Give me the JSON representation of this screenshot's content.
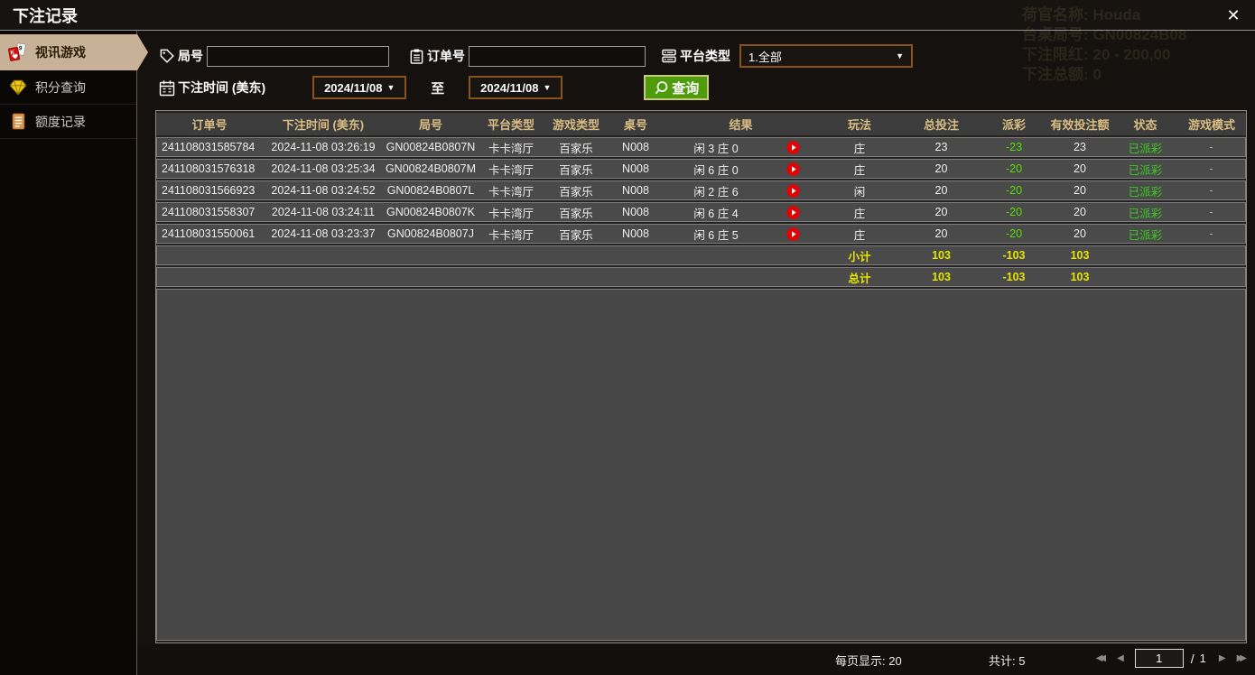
{
  "window": {
    "title": "下注记录",
    "close_icon": "✕"
  },
  "sidebar": {
    "items": [
      {
        "label": "视讯游戏",
        "icon": "playing-cards-icon",
        "active": true
      },
      {
        "label": "积分查询",
        "icon": "gem-icon",
        "active": false
      },
      {
        "label": "额度记录",
        "icon": "document-icon",
        "active": false
      }
    ]
  },
  "filters": {
    "round_label": "局号",
    "round_value": "",
    "order_label": "订单号",
    "order_value": "",
    "platform_label": "平台类型",
    "platform_value": "1.全部",
    "time_label": "下注时间 (美东)",
    "date_from": "2024/11/08",
    "to_label": "至",
    "date_to": "2024/11/08",
    "search_label": "查询",
    "caret": "▼"
  },
  "table": {
    "columns": [
      "订单号",
      "下注时间 (美东)",
      "局号",
      "平台类型",
      "游戏类型",
      "桌号",
      "结果",
      "玩法",
      "总投注",
      "派彩",
      "有效投注额",
      "状态",
      "游戏模式"
    ],
    "rows": [
      {
        "order_no": "241108031585784",
        "bet_time": "2024-11-08 03:26:19",
        "round_no": "GN00824B0807N",
        "platform": "卡卡湾厅",
        "game_type": "百家乐",
        "table_no": "N008",
        "result": "闲 3 庄 0",
        "play_type": "庄",
        "total_bet": "23",
        "payout": "-23",
        "valid_bet": "23",
        "status": "已派彩",
        "mode": "-"
      },
      {
        "order_no": "241108031576318",
        "bet_time": "2024-11-08 03:25:34",
        "round_no": "GN00824B0807M",
        "platform": "卡卡湾厅",
        "game_type": "百家乐",
        "table_no": "N008",
        "result": "闲 6 庄 0",
        "play_type": "庄",
        "total_bet": "20",
        "payout": "-20",
        "valid_bet": "20",
        "status": "已派彩",
        "mode": "-"
      },
      {
        "order_no": "241108031566923",
        "bet_time": "2024-11-08 03:24:52",
        "round_no": "GN00824B0807L",
        "platform": "卡卡湾厅",
        "game_type": "百家乐",
        "table_no": "N008",
        "result": "闲 2 庄 6",
        "play_type": "闲",
        "total_bet": "20",
        "payout": "-20",
        "valid_bet": "20",
        "status": "已派彩",
        "mode": "-"
      },
      {
        "order_no": "241108031558307",
        "bet_time": "2024-11-08 03:24:11",
        "round_no": "GN00824B0807K",
        "platform": "卡卡湾厅",
        "game_type": "百家乐",
        "table_no": "N008",
        "result": "闲 6 庄 4",
        "play_type": "庄",
        "total_bet": "20",
        "payout": "-20",
        "valid_bet": "20",
        "status": "已派彩",
        "mode": "-"
      },
      {
        "order_no": "241108031550061",
        "bet_time": "2024-11-08 03:23:37",
        "round_no": "GN00824B0807J",
        "platform": "卡卡湾厅",
        "game_type": "百家乐",
        "table_no": "N008",
        "result": "闲 6 庄 5",
        "play_type": "庄",
        "total_bet": "20",
        "payout": "-20",
        "valid_bet": "20",
        "status": "已派彩",
        "mode": "-"
      }
    ],
    "subtotal": {
      "label": "小计",
      "total_bet": "103",
      "payout": "-103",
      "valid_bet": "103"
    },
    "grand_total": {
      "label": "总计",
      "total_bet": "103",
      "payout": "-103",
      "valid_bet": "103"
    }
  },
  "pagination": {
    "per_page_label": "每页显示: 20",
    "total_label": "共计: 5",
    "current_page": "1",
    "separator": "/",
    "total_pages": "1",
    "first_icon": "◀◀",
    "prev_icon": "◀",
    "next_icon": "▶",
    "last_icon": "▶▶"
  },
  "background_bleed": {
    "lines": [
      "荷官名称: Houda",
      "台桌局号: GN00824B08",
      "下注限红: 20 - 200,00",
      "下注总额: 0"
    ]
  },
  "colors": {
    "active_tab_tan": "#c8b297",
    "header_gold": "#d9bd82",
    "totals_yellow": "#e6e400",
    "payout_green": "#55e000",
    "status_green": "#3ecc1e",
    "search_button_green": "#4e9c0c",
    "date_border_brown": "#8a5317",
    "play_icon_red": "#e00404",
    "row_gray": "#4a4a4a"
  }
}
